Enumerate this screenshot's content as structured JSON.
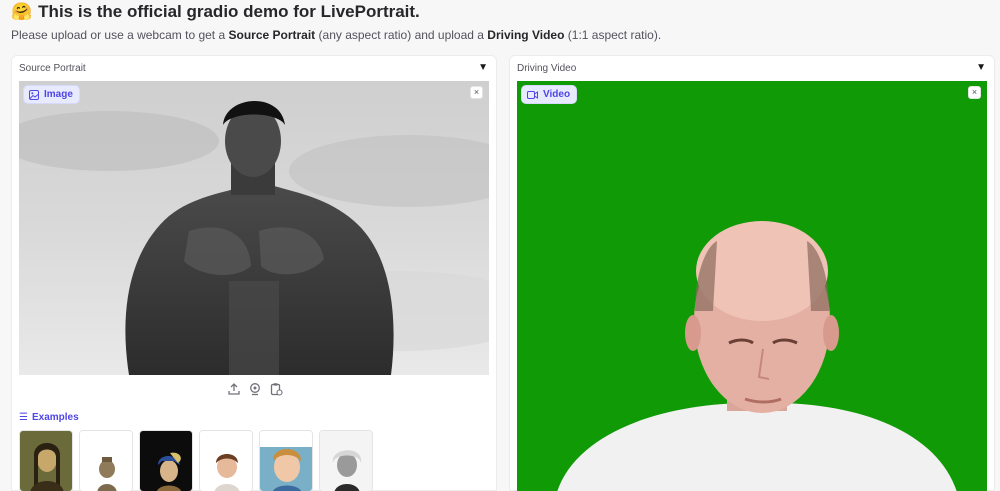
{
  "header": {
    "emoji": "🤗",
    "title": "This is the official gradio demo for LivePortrait.",
    "subtitle_parts": [
      "Please upload or use a webcam to get a ",
      "Source Portrait",
      " (any aspect ratio) and upload a ",
      "Driving Video",
      " (1:1 aspect ratio)."
    ]
  },
  "source_panel": {
    "title": "Source Portrait",
    "badge": "Image",
    "badge_icon": "image-icon",
    "close": "×",
    "tools": [
      "upload-icon",
      "webcam-icon",
      "clipboard-icon"
    ],
    "examples_label": "Examples",
    "examples": [
      "mona-lisa",
      "terracotta-warrior",
      "girl-with-pearl-earring",
      "child-portrait",
      "cartoon-boy",
      "einstein"
    ]
  },
  "driving_panel": {
    "title": "Driving Video",
    "badge": "Video",
    "badge_icon": "video-icon",
    "close": "×"
  },
  "colors": {
    "accent": "#4f46e5",
    "green_screen": "#0f9a06"
  }
}
